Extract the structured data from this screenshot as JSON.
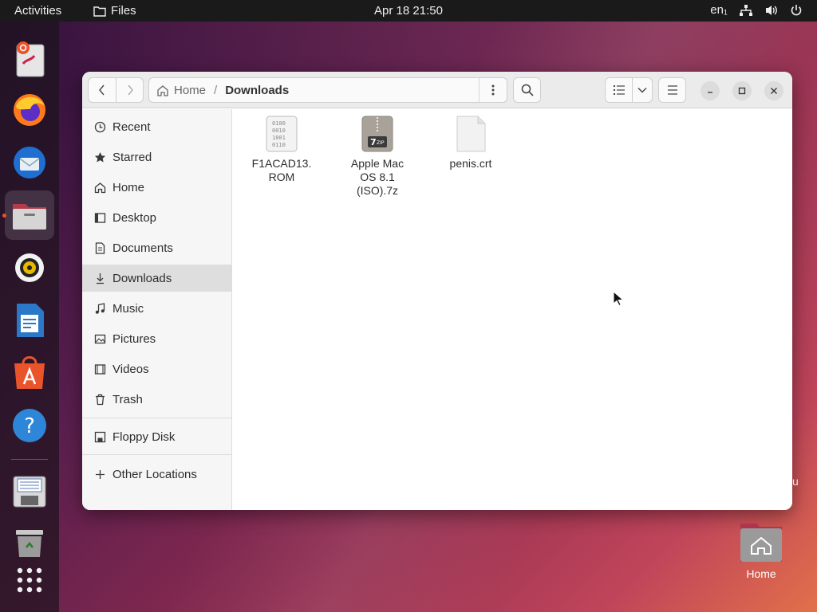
{
  "topbar": {
    "activities": "Activities",
    "app_name": "Files",
    "clock": "Apr 18  21:50",
    "input_source": "en₁"
  },
  "dock": {
    "items": [
      "ubuntu-installer",
      "firefox",
      "thunderbird",
      "files",
      "rhythmbox",
      "libreoffice-writer",
      "app-center",
      "help",
      "floppy-disk",
      "trash",
      "show-apps"
    ]
  },
  "window": {
    "path": {
      "home": "Home",
      "separator": "/",
      "current": "Downloads"
    },
    "sidebar": {
      "items": [
        {
          "label": "Recent",
          "icon": "clock-icon"
        },
        {
          "label": "Starred",
          "icon": "star-icon"
        },
        {
          "label": "Home",
          "icon": "home-icon"
        },
        {
          "label": "Desktop",
          "icon": "desktop-icon"
        },
        {
          "label": "Documents",
          "icon": "document-icon"
        },
        {
          "label": "Downloads",
          "icon": "download-icon"
        },
        {
          "label": "Music",
          "icon": "music-icon"
        },
        {
          "label": "Pictures",
          "icon": "pictures-icon"
        },
        {
          "label": "Videos",
          "icon": "videos-icon"
        },
        {
          "label": "Trash",
          "icon": "trash-icon"
        }
      ],
      "devices": [
        {
          "label": "Floppy Disk",
          "icon": "floppy-icon"
        }
      ],
      "other": {
        "label": "Other Locations",
        "icon": "plus-icon"
      }
    },
    "files": [
      {
        "name_line1": "F1ACAD13.",
        "name_line2": "ROM",
        "name_line3": "",
        "icon": "binary-file-icon"
      },
      {
        "name_line1": "Apple Mac",
        "name_line2": "OS 8.1",
        "name_line3": "(ISO).7z",
        "icon": "7zip-archive-icon"
      },
      {
        "name_line1": "penis.crt",
        "name_line2": "",
        "name_line3": "",
        "icon": "blank-file-icon"
      }
    ]
  },
  "desktop": {
    "home_label": "Home",
    "edge_glyph": "u"
  },
  "colors": {
    "accent": "#e9542a",
    "sidebar_bg": "#f6f6f6",
    "selected_bg": "#dedede",
    "topbar_bg": "#1a1a1a"
  }
}
